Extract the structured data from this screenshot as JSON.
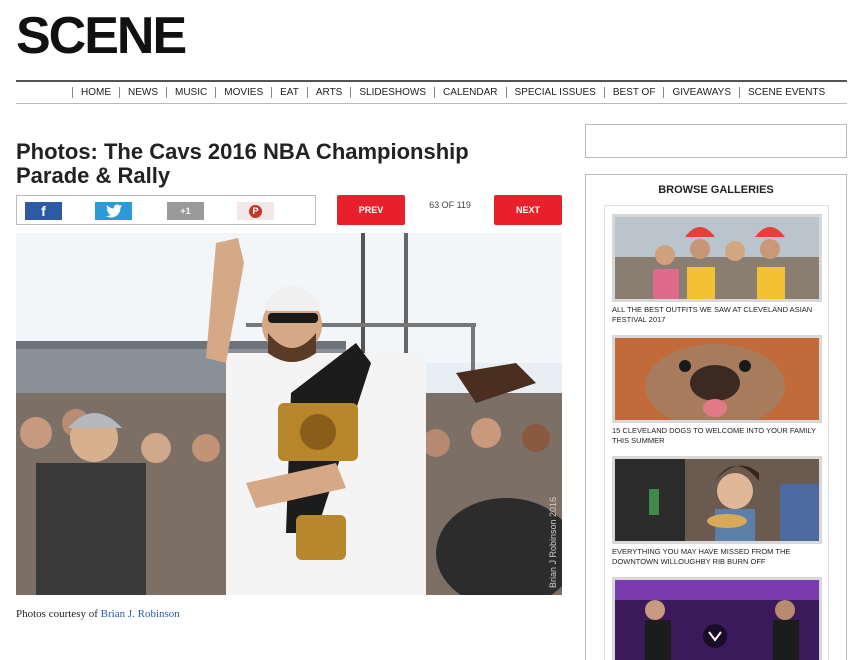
{
  "site": {
    "logo": "SCENE"
  },
  "nav": [
    "HOME",
    "NEWS",
    "MUSIC",
    "MOVIES",
    "EAT",
    "ARTS",
    "SLIDESHOWS",
    "CALENDAR",
    "SPECIAL ISSUES",
    "BEST OF",
    "GIVEAWAYS",
    "SCENE EVENTS"
  ],
  "article": {
    "title_line1": "Photos: The Cavs 2016 NBA Championship",
    "title_line2": "Parade & Rally"
  },
  "share": {
    "facebook": "f",
    "twitter": "t",
    "googleplus": "+1",
    "pinterest": "P"
  },
  "pager": {
    "prev": "PREV",
    "next": "NEXT",
    "counter": "63 OF 119"
  },
  "photo": {
    "watermark": "Brian J Robinson 2016"
  },
  "caption": {
    "prefix": "Photos courtesy of ",
    "author": "Brian J. Robinson"
  },
  "sidebar": {
    "title": "BROWSE GALLERIES",
    "galleries": [
      {
        "caption": "ALL THE BEST OUTFITS WE SAW AT CLEVELAND ASIAN FESTIVAL 2017"
      },
      {
        "caption": "15 CLEVELAND DOGS TO WELCOME INTO YOUR FAMILY THIS SUMMER"
      },
      {
        "caption": "EVERYTHING YOU MAY HAVE MISSED FROM THE DOWNTOWN WILLOUGHBY RIB BURN OFF"
      },
      {
        "caption": ""
      }
    ]
  },
  "colors": {
    "accent_red": "#e8202b",
    "facebook": "#2d5aa3",
    "twitter": "#2a9bd8",
    "link": "#2d5aa3"
  }
}
